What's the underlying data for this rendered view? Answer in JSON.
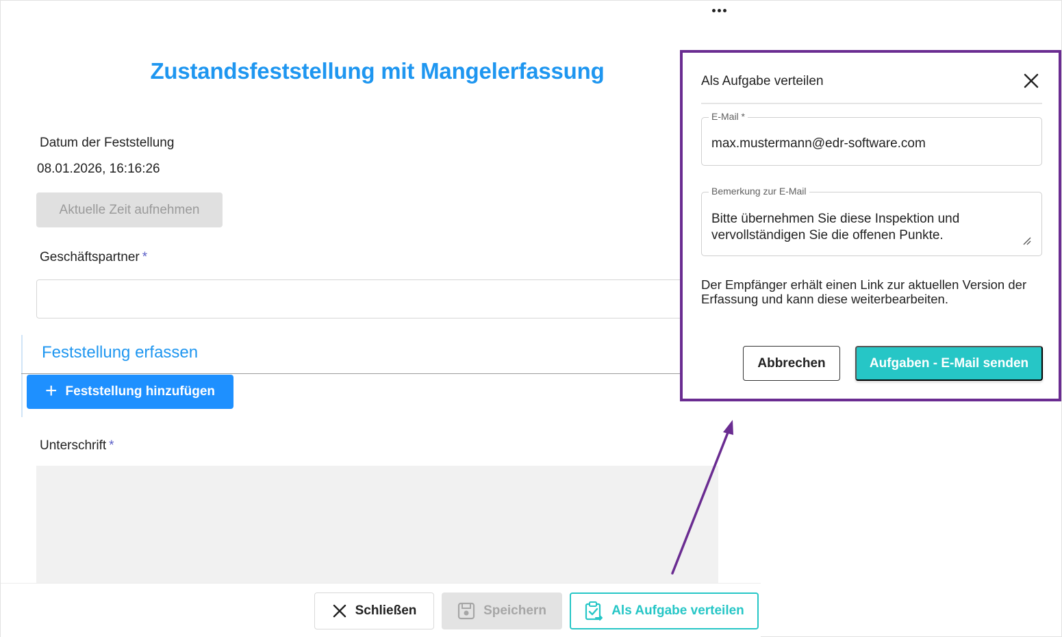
{
  "page": {
    "title": "Zustandsfeststellung mit Mangelerfassung"
  },
  "form": {
    "date_label": "Datum der Feststellung",
    "date_value": "08.01.2026, 16:16:26",
    "now_button_label": "Aktuelle Zeit aufnehmen",
    "partner_label": "Geschäftspartner",
    "partner_required_mark": "*",
    "partner_value": "",
    "section_title": "Feststellung erfassen",
    "add_finding_label": "Feststellung hinzufügen",
    "signature_label": "Unterschrift",
    "signature_required_mark": "*"
  },
  "footer": {
    "close_label": "Schließen",
    "save_label": "Speichern",
    "assign_label": "Als Aufgabe verteilen"
  },
  "dialog": {
    "title": "Als Aufgabe verteilen",
    "email_legend": "E-Mail *",
    "email_value": "max.mustermann@edr-software.com",
    "remark_legend": "Bemerkung zur E-Mail",
    "remark_value": "Bitte übernehmen Sie diese Inspektion und vervollständigen Sie die offenen Punkte.",
    "info_text": "Der Empfänger erhält einen Link zur aktuellen Version der Erfassung und kann diese weiterbearbeiten.",
    "cancel_label": "Abbrechen",
    "send_label": "Aufgaben - E-Mail senden"
  },
  "colors": {
    "accent_blue": "#1e96f0",
    "primary_button": "#1e90ff",
    "teal": "#26c6c6",
    "highlight_purple": "#6a2c91",
    "required_mark": "#5b5fc7"
  },
  "icons": {
    "more": "more-horizontal-icon",
    "close": "close-icon",
    "save": "floppy-disk-icon",
    "assign": "clipboard-check-icon",
    "plus": "plus-icon"
  }
}
